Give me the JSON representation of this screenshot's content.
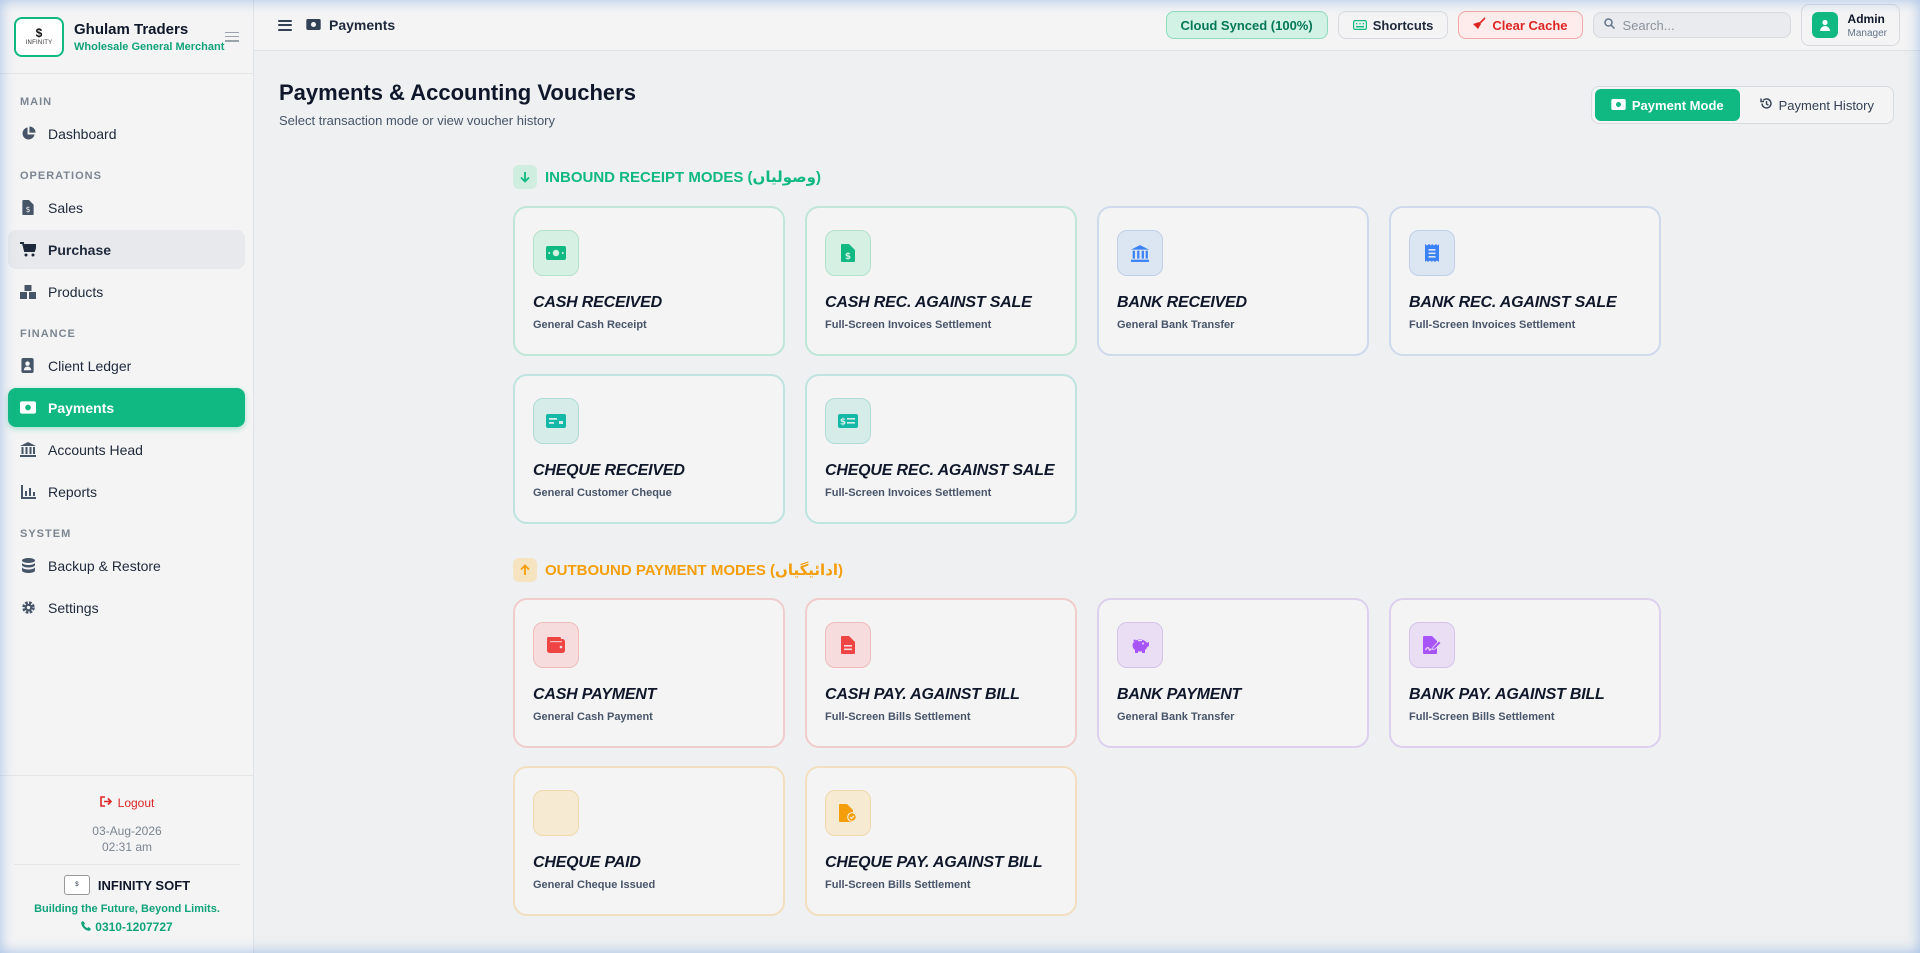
{
  "brand": {
    "logo_text": "INFINITY",
    "title": "Ghulam Traders",
    "subtitle": "Wholesale General Merchant"
  },
  "sidebar": {
    "sections": {
      "main": "MAIN",
      "operations": "OPERATIONS",
      "finance": "FINANCE",
      "system": "SYSTEM"
    },
    "items": {
      "dashboard": "Dashboard",
      "sales": "Sales",
      "purchase": "Purchase",
      "products": "Products",
      "client_ledger": "Client Ledger",
      "payments": "Payments",
      "accounts_head": "Accounts Head",
      "reports": "Reports",
      "backup_restore": "Backup & Restore",
      "settings": "Settings"
    },
    "footer": {
      "logout": "Logout",
      "date": "03-Aug-2026",
      "time": "02:31 am",
      "company": "INFINITY SOFT",
      "tagline": "Building the Future, Beyond Limits.",
      "phone": "0310-1207727"
    }
  },
  "topbar": {
    "breadcrumb": "Payments",
    "sync_status": "Cloud Synced (100%)",
    "shortcuts": "Shortcuts",
    "clear_cache": "Clear Cache",
    "search_placeholder": "Search...",
    "user": {
      "name": "Admin",
      "role": "Manager"
    }
  },
  "page": {
    "title": "Payments & Accounting Vouchers",
    "subtitle": "Select transaction mode or view voucher history",
    "mode_toggle": {
      "payment_mode": "Payment Mode",
      "payment_history": "Payment History"
    }
  },
  "inbound": {
    "heading": "INBOUND RECEIPT MODES (وصولیاں)",
    "cards": {
      "cash_received": {
        "title": "CASH RECEIVED",
        "subtitle": "General Cash Receipt"
      },
      "cash_rec_sale": {
        "title": "CASH REC. AGAINST SALE",
        "subtitle": "Full-Screen Invoices Settlement"
      },
      "bank_received": {
        "title": "BANK RECEIVED",
        "subtitle": "General Bank Transfer"
      },
      "bank_rec_sale": {
        "title": "BANK REC. AGAINST SALE",
        "subtitle": "Full-Screen Invoices Settlement"
      },
      "cheque_received": {
        "title": "CHEQUE RECEIVED",
        "subtitle": "General Customer Cheque"
      },
      "cheque_rec_sale": {
        "title": "CHEQUE REC. AGAINST SALE",
        "subtitle": "Full-Screen Invoices Settlement"
      }
    }
  },
  "outbound": {
    "heading": "OUTBOUND PAYMENT MODES (ادائیگیاں)",
    "cards": {
      "cash_payment": {
        "title": "CASH PAYMENT",
        "subtitle": "General Cash Payment"
      },
      "cash_pay_bill": {
        "title": "CASH PAY. AGAINST BILL",
        "subtitle": "Full-Screen Bills Settlement"
      },
      "bank_payment": {
        "title": "BANK PAYMENT",
        "subtitle": "General Bank Transfer"
      },
      "bank_pay_bill": {
        "title": "BANK PAY. AGAINST BILL",
        "subtitle": "Full-Screen Bills Settlement"
      },
      "cheque_paid": {
        "title": "CHEQUE PAID",
        "subtitle": "General Cheque Issued"
      },
      "cheque_pay_bill": {
        "title": "CHEQUE PAY. AGAINST BILL",
        "subtitle": "Full-Screen Bills Settlement"
      }
    }
  },
  "colors": {
    "accent": "#10b981",
    "inbound_heading": "#10b981",
    "outbound_heading": "#f59e0b",
    "danger": "#dc2626"
  }
}
